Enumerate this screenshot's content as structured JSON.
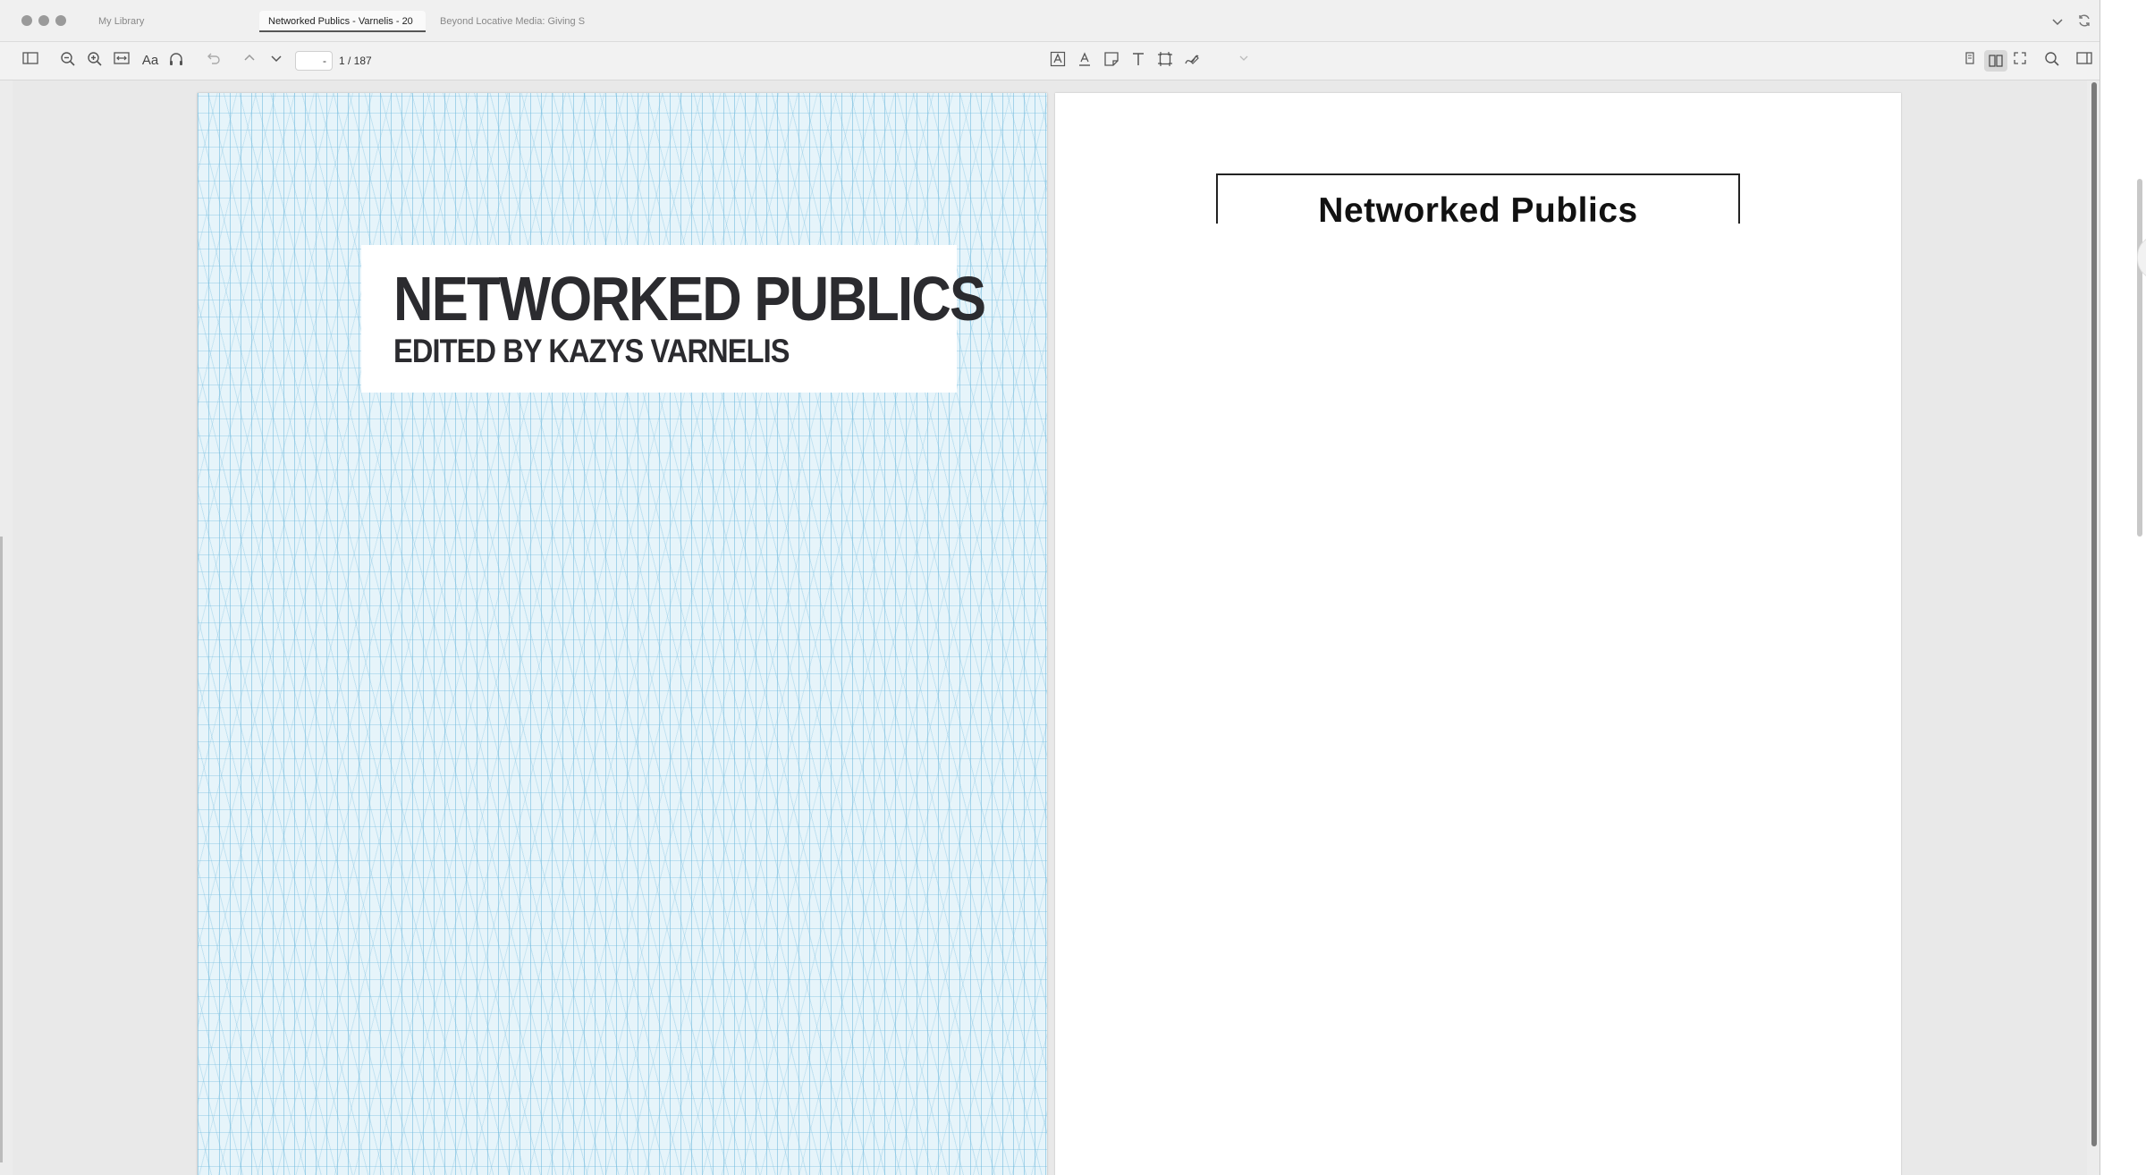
{
  "tabs": [
    {
      "label": "My Library"
    },
    {
      "label": "Networked Publics - Varnelis - 20"
    },
    {
      "label": "Beyond Locative Media: Giving S"
    }
  ],
  "toolbar": {
    "page_value": "-",
    "page_total": "1 / 187",
    "font_label": "Aa"
  },
  "icons": {
    "sidebar": "sidebar-toggle-icon",
    "zoom_out": "zoom-out-icon",
    "zoom_in": "zoom-in-icon",
    "fit": "fit-width-icon",
    "font": "font-size-icon",
    "read_aloud": "headphones-icon",
    "undo": "undo-icon",
    "prev": "chevron-up-icon",
    "next": "chevron-down-icon",
    "highlight": "highlight-text-icon",
    "underline": "underline-text-icon",
    "note": "note-icon",
    "text": "text-icon",
    "area": "area-select-icon",
    "ink": "ink-icon",
    "color": "color-dropdown-icon",
    "single": "single-page-icon",
    "spread": "two-page-icon",
    "fullscreen": "fullscreen-icon",
    "search": "search-icon",
    "right_pane": "right-pane-icon",
    "tabs_menu": "tabs-dropdown-icon",
    "sync": "sync-icon"
  },
  "document": {
    "cover_title": "NETWORKED PUBLICS",
    "cover_subtitle": "EDITED BY KAZYS VARNELIS",
    "half_title": "Networked Publics"
  },
  "colors": {
    "cover_background": "#e6f4fa",
    "cover_grid": "#6cb8dc",
    "cover_text": "#2b2b2f"
  }
}
